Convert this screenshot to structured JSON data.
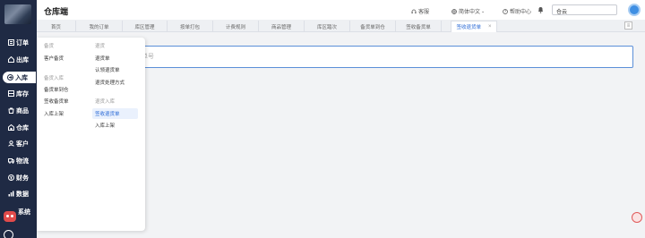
{
  "app": {
    "title": "仓库端"
  },
  "header": {
    "customer_service": "客服",
    "language": "简体中文",
    "help_center": "帮助中心",
    "warehouse_select": "仓云"
  },
  "sidebar": {
    "items": [
      {
        "label": "订单"
      },
      {
        "label": "出库"
      },
      {
        "label": "入库"
      },
      {
        "label": "库存"
      },
      {
        "label": "商品"
      },
      {
        "label": "仓库"
      },
      {
        "label": "客户"
      },
      {
        "label": "物流"
      },
      {
        "label": "财务"
      },
      {
        "label": "数据"
      },
      {
        "label": "系统"
      }
    ],
    "active_index": 2
  },
  "tabs": [
    {
      "label": "首页"
    },
    {
      "label": "我的订单"
    },
    {
      "label": "库区管理"
    },
    {
      "label": "按单打包"
    },
    {
      "label": "计费规则"
    },
    {
      "label": "商品管理"
    },
    {
      "label": "库区踏次"
    },
    {
      "label": "备货单到仓"
    },
    {
      "label": "签收备货单"
    },
    {
      "label": "签收退货单",
      "active": true,
      "close": "×"
    }
  ],
  "tab_menu_icon": "≡",
  "search": {
    "placeholder": "运单号"
  },
  "flyout": {
    "col1": {
      "group1": "备货",
      "g1_items": [
        "客户备货"
      ],
      "group2": "备货入库",
      "g2_items": [
        "备货单到仓",
        "签收备货单",
        "入库上架"
      ]
    },
    "col2": {
      "group1": "退货",
      "g1_items": [
        "退货单",
        "认领退货单",
        "退货处理方式"
      ],
      "group2": "退货入库",
      "g2_items": [
        "签收退货单",
        "入库上架"
      ],
      "highlighted": "签收退货单"
    }
  },
  "colors": {
    "sidebar_bg": "#1f2a44",
    "accent": "#2c6bd6"
  }
}
